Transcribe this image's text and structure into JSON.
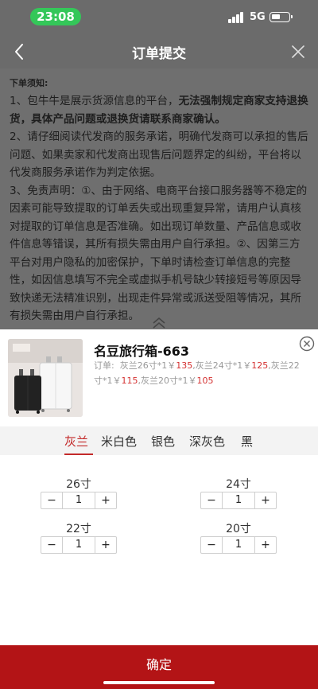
{
  "status_bar": {
    "time": "23:08",
    "network": "5G"
  },
  "nav": {
    "title": "订单提交",
    "back_icon": "chevron-left-icon",
    "close_icon": "close-icon"
  },
  "notice": {
    "title": "下单须知:",
    "p1_a": "1、包牛牛是展示货源信息的平台，",
    "p1_b": "无法强制规定商家支持退换货，具体产品问题或退换货请联系商家确认。",
    "p2": "2、请仔细阅读代发商的服务承诺，明确代发商可以承担的售后问题、如果卖家和代发商出现售后问题界定的纠纷，平台将以代发商服务承诺作为判定依据。",
    "p3": "3、免责声明：①、由于网络、电商平台接口服务器等不稳定的因素可能导致提取的订单丢失或出现重复异常，请用户认真核对提取的订单信息是否准确。如出现订单数量、产品信息或收件信息等错误，其所有损失需由用户自行承担。②、因第三方平台对用户隐私的加密保护，下单时请检查订单信息的完整性，如因信息填写不完全或虚拟手机号缺少转接短号等原因导致快递无法精准识别，出现走件异常或派送受阻等情况，其所有损失需由用户自行承担。"
  },
  "product": {
    "name": "名豆旅行箱-663",
    "order_label": "订单:",
    "items": [
      {
        "text": "灰兰26寸*1￥",
        "price": "135",
        "sep": ","
      },
      {
        "text": "灰兰24寸*1￥",
        "price": "125",
        "sep": ","
      },
      {
        "text": "灰兰22寸*1￥",
        "price": "115",
        "sep": ","
      },
      {
        "text": "灰兰20寸*1￥",
        "price": "105",
        "sep": ""
      }
    ]
  },
  "colors": [
    "灰兰",
    "米白色",
    "银色",
    "深灰色",
    "黑"
  ],
  "selected_color": "灰兰",
  "sizes": [
    {
      "label": "26寸",
      "qty": "1"
    },
    {
      "label": "24寸",
      "qty": "1"
    },
    {
      "label": "22寸",
      "qty": "1"
    },
    {
      "label": "20寸",
      "qty": "1"
    }
  ],
  "stepper": {
    "minus": "−",
    "plus": "+"
  },
  "confirm_label": "确定",
  "colors_theme": {
    "accent": "#c32a2a",
    "confirm_bg": "#b31416",
    "price": "#d43030",
    "time_pill": "#34c759"
  }
}
